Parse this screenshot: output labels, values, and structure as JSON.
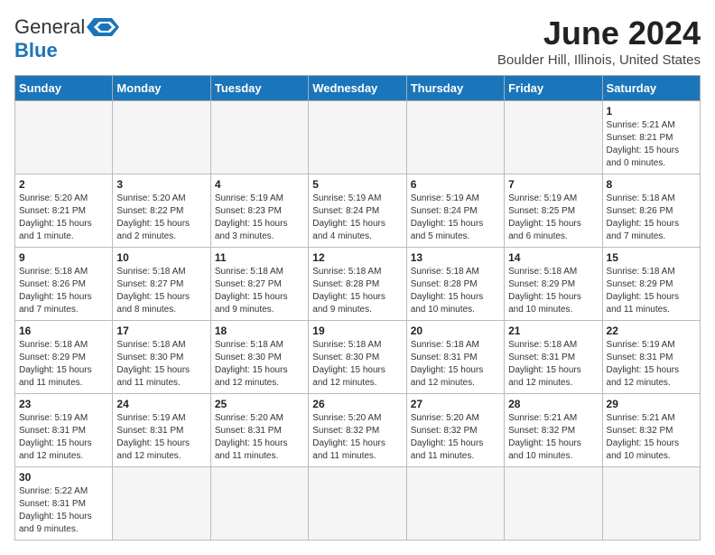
{
  "logo": {
    "general": "General",
    "blue": "Blue"
  },
  "title": "June 2024",
  "location": "Boulder Hill, Illinois, United States",
  "days_of_week": [
    "Sunday",
    "Monday",
    "Tuesday",
    "Wednesday",
    "Thursday",
    "Friday",
    "Saturday"
  ],
  "weeks": [
    [
      {
        "day": "",
        "info": ""
      },
      {
        "day": "",
        "info": ""
      },
      {
        "day": "",
        "info": ""
      },
      {
        "day": "",
        "info": ""
      },
      {
        "day": "",
        "info": ""
      },
      {
        "day": "",
        "info": ""
      },
      {
        "day": "1",
        "info": "Sunrise: 5:21 AM\nSunset: 8:21 PM\nDaylight: 15 hours and 0 minutes."
      }
    ],
    [
      {
        "day": "2",
        "info": "Sunrise: 5:20 AM\nSunset: 8:21 PM\nDaylight: 15 hours and 1 minute."
      },
      {
        "day": "3",
        "info": "Sunrise: 5:20 AM\nSunset: 8:22 PM\nDaylight: 15 hours and 2 minutes."
      },
      {
        "day": "4",
        "info": "Sunrise: 5:19 AM\nSunset: 8:23 PM\nDaylight: 15 hours and 3 minutes."
      },
      {
        "day": "5",
        "info": "Sunrise: 5:19 AM\nSunset: 8:24 PM\nDaylight: 15 hours and 4 minutes."
      },
      {
        "day": "6",
        "info": "Sunrise: 5:19 AM\nSunset: 8:24 PM\nDaylight: 15 hours and 5 minutes."
      },
      {
        "day": "7",
        "info": "Sunrise: 5:19 AM\nSunset: 8:25 PM\nDaylight: 15 hours and 6 minutes."
      },
      {
        "day": "8",
        "info": "Sunrise: 5:18 AM\nSunset: 8:26 PM\nDaylight: 15 hours and 7 minutes."
      }
    ],
    [
      {
        "day": "9",
        "info": "Sunrise: 5:18 AM\nSunset: 8:26 PM\nDaylight: 15 hours and 7 minutes."
      },
      {
        "day": "10",
        "info": "Sunrise: 5:18 AM\nSunset: 8:27 PM\nDaylight: 15 hours and 8 minutes."
      },
      {
        "day": "11",
        "info": "Sunrise: 5:18 AM\nSunset: 8:27 PM\nDaylight: 15 hours and 9 minutes."
      },
      {
        "day": "12",
        "info": "Sunrise: 5:18 AM\nSunset: 8:28 PM\nDaylight: 15 hours and 9 minutes."
      },
      {
        "day": "13",
        "info": "Sunrise: 5:18 AM\nSunset: 8:28 PM\nDaylight: 15 hours and 10 minutes."
      },
      {
        "day": "14",
        "info": "Sunrise: 5:18 AM\nSunset: 8:29 PM\nDaylight: 15 hours and 10 minutes."
      },
      {
        "day": "15",
        "info": "Sunrise: 5:18 AM\nSunset: 8:29 PM\nDaylight: 15 hours and 11 minutes."
      }
    ],
    [
      {
        "day": "16",
        "info": "Sunrise: 5:18 AM\nSunset: 8:29 PM\nDaylight: 15 hours and 11 minutes."
      },
      {
        "day": "17",
        "info": "Sunrise: 5:18 AM\nSunset: 8:30 PM\nDaylight: 15 hours and 11 minutes."
      },
      {
        "day": "18",
        "info": "Sunrise: 5:18 AM\nSunset: 8:30 PM\nDaylight: 15 hours and 12 minutes."
      },
      {
        "day": "19",
        "info": "Sunrise: 5:18 AM\nSunset: 8:30 PM\nDaylight: 15 hours and 12 minutes."
      },
      {
        "day": "20",
        "info": "Sunrise: 5:18 AM\nSunset: 8:31 PM\nDaylight: 15 hours and 12 minutes."
      },
      {
        "day": "21",
        "info": "Sunrise: 5:18 AM\nSunset: 8:31 PM\nDaylight: 15 hours and 12 minutes."
      },
      {
        "day": "22",
        "info": "Sunrise: 5:19 AM\nSunset: 8:31 PM\nDaylight: 15 hours and 12 minutes."
      }
    ],
    [
      {
        "day": "23",
        "info": "Sunrise: 5:19 AM\nSunset: 8:31 PM\nDaylight: 15 hours and 12 minutes."
      },
      {
        "day": "24",
        "info": "Sunrise: 5:19 AM\nSunset: 8:31 PM\nDaylight: 15 hours and 12 minutes."
      },
      {
        "day": "25",
        "info": "Sunrise: 5:20 AM\nSunset: 8:31 PM\nDaylight: 15 hours and 11 minutes."
      },
      {
        "day": "26",
        "info": "Sunrise: 5:20 AM\nSunset: 8:32 PM\nDaylight: 15 hours and 11 minutes."
      },
      {
        "day": "27",
        "info": "Sunrise: 5:20 AM\nSunset: 8:32 PM\nDaylight: 15 hours and 11 minutes."
      },
      {
        "day": "28",
        "info": "Sunrise: 5:21 AM\nSunset: 8:32 PM\nDaylight: 15 hours and 10 minutes."
      },
      {
        "day": "29",
        "info": "Sunrise: 5:21 AM\nSunset: 8:32 PM\nDaylight: 15 hours and 10 minutes."
      }
    ],
    [
      {
        "day": "30",
        "info": "Sunrise: 5:22 AM\nSunset: 8:31 PM\nDaylight: 15 hours and 9 minutes."
      },
      {
        "day": "",
        "info": ""
      },
      {
        "day": "",
        "info": ""
      },
      {
        "day": "",
        "info": ""
      },
      {
        "day": "",
        "info": ""
      },
      {
        "day": "",
        "info": ""
      },
      {
        "day": "",
        "info": ""
      }
    ]
  ]
}
